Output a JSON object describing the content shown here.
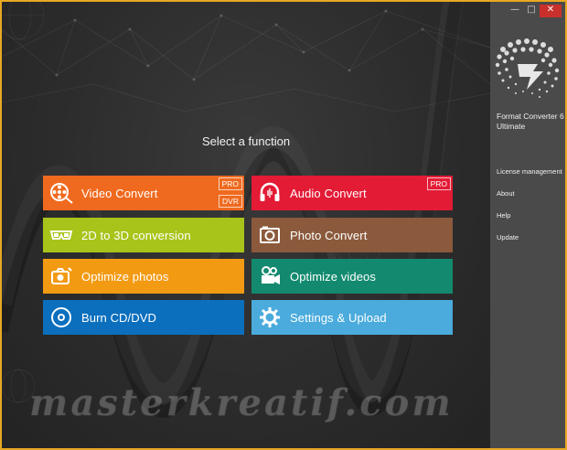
{
  "window": {
    "controls": {
      "minimize": "—",
      "maximize": "□",
      "close": "✕"
    }
  },
  "sidebar": {
    "product_line1": "Format Converter 6",
    "product_line2": "Ultimate",
    "links": [
      {
        "label": "License management"
      },
      {
        "label": "About"
      },
      {
        "label": "Help"
      },
      {
        "label": "Update"
      }
    ]
  },
  "main": {
    "heading": "Select a function",
    "tiles": [
      {
        "label": "Video Convert",
        "icon": "film-reel-icon",
        "color": "#ef6a1f",
        "badges": [
          "PRO",
          "DVR"
        ]
      },
      {
        "label": "Audio Convert",
        "icon": "headphones-icon",
        "color": "#e31b35",
        "badges": [
          "PRO"
        ]
      },
      {
        "label": "2D to 3D conversion",
        "icon": "3d-glasses-icon",
        "color": "#a8c41a",
        "badges": []
      },
      {
        "label": "Photo Convert",
        "icon": "photo-icon",
        "color": "#8b5a3c",
        "badges": []
      },
      {
        "label": "Optimize photos",
        "icon": "camera-icon",
        "color": "#f39a13",
        "badges": []
      },
      {
        "label": "Optimize videos",
        "icon": "video-camera-icon",
        "color": "#138a6f",
        "badges": []
      },
      {
        "label": "Burn CD/DVD",
        "icon": "disc-icon",
        "color": "#0b6fbd",
        "badges": []
      },
      {
        "label": "Settings & Upload",
        "icon": "gear-icon",
        "color": "#4aabdc",
        "badges": []
      }
    ]
  },
  "watermark": "masterkreatif.com"
}
